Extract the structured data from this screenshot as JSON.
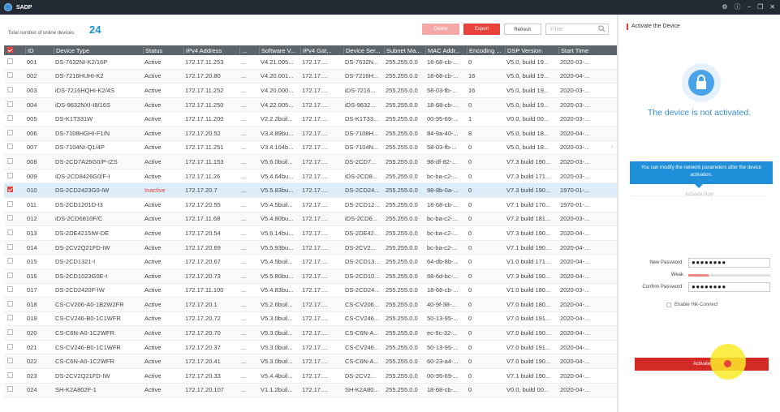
{
  "app": {
    "title": "SADP"
  },
  "summary": {
    "label": "Total number of online devices:",
    "count": "24"
  },
  "toolbar": {
    "delete_label": "Delete",
    "export_label": "Export",
    "refresh_label": "Refresh",
    "filter_placeholder": "Filter"
  },
  "table": {
    "headers": [
      "",
      "ID",
      "Device Type",
      "Status",
      "IPv4 Address",
      "...",
      "Software V...",
      "IPv4 Gat...",
      "Device Ser...",
      "Subnet Ma...",
      "MAC Addr...",
      "Encoding ...",
      "DSP Version",
      "Start Time",
      ""
    ],
    "rows": [
      {
        "id": "001",
        "type": "DS-7632NI-K2/16P",
        "status": "Active",
        "ip": "172.17.11.253",
        "port": "...",
        "sw": "V4.21.005...",
        "gw": "172.17....",
        "serial": "DS-7632N...",
        "mask": "255.255.0.0",
        "mac": "18-68-cb-...",
        "enc": "0",
        "dsp": "V5.0, build 19...",
        "start": "2020-03-..."
      },
      {
        "id": "002",
        "type": "DS-7216HUHI-K2",
        "status": "Active",
        "ip": "172.17.20.80",
        "port": "...",
        "sw": "V4.20.001...",
        "gw": "172.17....",
        "serial": "DS-7216H...",
        "mask": "255.255.0.0",
        "mac": "18-68-cb-...",
        "enc": "16",
        "dsp": "V5.0, build 19...",
        "start": "2020-04-..."
      },
      {
        "id": "003",
        "type": "iDS-7216HQHI-K2/4S",
        "status": "Active",
        "ip": "172.17.11.252",
        "port": "...",
        "sw": "V4.20.000...",
        "gw": "172.17....",
        "serial": "iDS-7216...",
        "mask": "255.255.0.0",
        "mac": "58-03-fb-...",
        "enc": "16",
        "dsp": "V5.0, build 19...",
        "start": "2020-03-..."
      },
      {
        "id": "004",
        "type": "iDS-9632NXI-I8/16S",
        "status": "Active",
        "ip": "172.17.11.250",
        "port": "...",
        "sw": "V4.22.005...",
        "gw": "172.17....",
        "serial": "iDS-9632...",
        "mask": "255.255.0.0",
        "mac": "18-68-cb-...",
        "enc": "0",
        "dsp": "V5.0, build 19...",
        "start": "2020-03-..."
      },
      {
        "id": "005",
        "type": "DS-K1T331W",
        "status": "Active",
        "ip": "172.17.11.200",
        "port": "...",
        "sw": "V2.2.2buil...",
        "gw": "172.17....",
        "serial": "DS-K1T33...",
        "mask": "255.255.0.0",
        "mac": "00-95-69-...",
        "enc": "1",
        "dsp": "V0.0, build 00...",
        "start": "2020-03-..."
      },
      {
        "id": "006",
        "type": "DS-7108HGHI-F1/N",
        "status": "Active",
        "ip": "172.17.20.52",
        "port": "...",
        "sw": "V3.4.89bu...",
        "gw": "172.17....",
        "serial": "DS-7108H...",
        "mask": "255.255.0.0",
        "mac": "84-9a-40-...",
        "enc": "8",
        "dsp": "V5.0, build 18...",
        "start": "2020-04-..."
      },
      {
        "id": "007",
        "type": "DS-7104NI-Q1/4P",
        "status": "Active",
        "ip": "172.17.11.251",
        "port": "...",
        "sw": "V3.4.104b...",
        "gw": "172.17....",
        "serial": "DS-7104N...",
        "mask": "255.255.0.0",
        "mac": "58-03-fb-...",
        "enc": "0",
        "dsp": "V5.0, build 18...",
        "start": "2020-03-..."
      },
      {
        "id": "008",
        "type": "DS-2CD7A26G0/P-IZS",
        "status": "Active",
        "ip": "172.17.11.153",
        "port": "...",
        "sw": "V5.6.0buil...",
        "gw": "172.17....",
        "serial": "DS-2CD7...",
        "mask": "255.255.0.0",
        "mac": "98-df-82-...",
        "enc": "0",
        "dsp": "V7.3 build 190...",
        "start": "2020-03-..."
      },
      {
        "id": "009",
        "type": "iDS-2CD8426G0/F-I",
        "status": "Active",
        "ip": "172.17.11.26",
        "port": "...",
        "sw": "V5.4.64bu...",
        "gw": "172.17....",
        "serial": "iDS-2CD8...",
        "mask": "255.255.0.0",
        "mac": "bc-ba-c2-...",
        "enc": "0",
        "dsp": "V7.3 build 171...",
        "start": "2020-03-..."
      },
      {
        "id": "010",
        "type": "DS-2CD2423G0-IW",
        "status": "Inactive",
        "ip": "172.17.20.7",
        "port": "...",
        "sw": "V5.5.83bu...",
        "gw": "172.17....",
        "serial": "DS-2CD24...",
        "mask": "255.255.0.0",
        "mac": "98-8b-0a-...",
        "enc": "0",
        "dsp": "V7.3 build 190...",
        "start": "1970-01-..."
      },
      {
        "id": "011",
        "type": "DS-2CD1201D-I3",
        "status": "Active",
        "ip": "172.17.20.55",
        "port": "...",
        "sw": "V5.4.5buil...",
        "gw": "172.17....",
        "serial": "DS-2CD12...",
        "mask": "255.255.0.0",
        "mac": "18-68-cb-...",
        "enc": "0",
        "dsp": "V7.1 build 170...",
        "start": "1970-01-..."
      },
      {
        "id": "012",
        "type": "iDS-2CD6810F/C",
        "status": "Active",
        "ip": "172.17.11.68",
        "port": "...",
        "sw": "V5.4.80bu...",
        "gw": "172.17....",
        "serial": "iDS-2CD6...",
        "mask": "255.255.0.0",
        "mac": "bc-ba-c2-...",
        "enc": "0",
        "dsp": "V7.2 build 181...",
        "start": "2020-03-..."
      },
      {
        "id": "013",
        "type": "DS-2DE4215IW-DE",
        "status": "Active",
        "ip": "172.17.20.54",
        "port": "...",
        "sw": "V5.6.14bu...",
        "gw": "172.17....",
        "serial": "DS-2DE42...",
        "mask": "255.255.0.0",
        "mac": "bc-ba-c2-...",
        "enc": "0",
        "dsp": "V7.3 build 190...",
        "start": "2020-04-..."
      },
      {
        "id": "014",
        "type": "DS-2CV2Q21FD-IW",
        "status": "Active",
        "ip": "172.17.20.69",
        "port": "...",
        "sw": "V5.5.93bu...",
        "gw": "172.17....",
        "serial": "DS-2CV2...",
        "mask": "255.255.0.0",
        "mac": "bc-ba-c2-...",
        "enc": "0",
        "dsp": "V7.1 build 190...",
        "start": "2020-04-..."
      },
      {
        "id": "015",
        "type": "DS-2CD1321-I",
        "status": "Active",
        "ip": "172.17.20.67",
        "port": "...",
        "sw": "V5.4.5buil...",
        "gw": "172.17....",
        "serial": "DS-2CD13...",
        "mask": "255.255.0.0",
        "mac": "64-db-8b-...",
        "enc": "0",
        "dsp": "V1.0 build 171...",
        "start": "2020-04-..."
      },
      {
        "id": "016",
        "type": "DS-2CD1023G0E-I",
        "status": "Active",
        "ip": "172.17.20.73",
        "port": "...",
        "sw": "V5.5.80bu...",
        "gw": "172.17....",
        "serial": "DS-2CD10...",
        "mask": "255.255.0.0",
        "mac": "68-6d-bc-...",
        "enc": "0",
        "dsp": "V7.3 build 190...",
        "start": "2020-04-..."
      },
      {
        "id": "017",
        "type": "DS-2CD2420F-IW",
        "status": "Active",
        "ip": "172.17.11.100",
        "port": "...",
        "sw": "V5.4.83bu...",
        "gw": "172.17....",
        "serial": "DS-2CD24...",
        "mask": "255.255.0.0",
        "mac": "18-68-cb-...",
        "enc": "0",
        "dsp": "V1.0 build 180...",
        "start": "2020-03-..."
      },
      {
        "id": "018",
        "type": "CS-CV206-A0-1B2W2FR",
        "status": "Active",
        "ip": "172.17.20.1",
        "port": "...",
        "sw": "V5.2.6buil...",
        "gw": "172.17....",
        "serial": "CS-CV206...",
        "mask": "255.255.0.0",
        "mac": "40-9f-38-...",
        "enc": "0",
        "dsp": "V7.0 build 180...",
        "start": "2020-04-..."
      },
      {
        "id": "019",
        "type": "CS-CV246-B0-1C1WFR",
        "status": "Active",
        "ip": "172.17.20.72",
        "port": "...",
        "sw": "V5.3.0buil...",
        "gw": "172.17....",
        "serial": "CS-CV246...",
        "mask": "255.255.0.0",
        "mac": "50-13-95-...",
        "enc": "0",
        "dsp": "V7.0 build 191...",
        "start": "2020-04-..."
      },
      {
        "id": "020",
        "type": "CS-C6N-A0-1C2WFR",
        "status": "Active",
        "ip": "172.17.20.70",
        "port": "...",
        "sw": "V5.3.0buil...",
        "gw": "172.17....",
        "serial": "CS-C6N-A...",
        "mask": "255.255.0.0",
        "mac": "ec-9c-32-...",
        "enc": "0",
        "dsp": "V7.0 build 190...",
        "start": "2020-04-..."
      },
      {
        "id": "021",
        "type": "CS-CV246-B0-1C1WFR",
        "status": "Active",
        "ip": "172.17.20.37",
        "port": "...",
        "sw": "V5.3.0buil...",
        "gw": "172.17....",
        "serial": "CS-CV246...",
        "mask": "255.255.0.0",
        "mac": "50-13-95-...",
        "enc": "0",
        "dsp": "V7.0 build 191...",
        "start": "2020-04-..."
      },
      {
        "id": "022",
        "type": "CS-C6N-A0-1C2WFR",
        "status": "Active",
        "ip": "172.17.20.41",
        "port": "...",
        "sw": "V5.3.0buil...",
        "gw": "172.17....",
        "serial": "CS-C6N-A...",
        "mask": "255.255.0.0",
        "mac": "60-23-a4-...",
        "enc": "0",
        "dsp": "V7.0 build 190...",
        "start": "2020-04-..."
      },
      {
        "id": "023",
        "type": "DS-2CV2Q21FD-IW",
        "status": "Active",
        "ip": "172.17.20.33",
        "port": "...",
        "sw": "V5.4.4buil...",
        "gw": "172.17....",
        "serial": "DS-2CV2...",
        "mask": "255.255.0.0",
        "mac": "00-95-69-...",
        "enc": "0",
        "dsp": "V7.1 build 190...",
        "start": "2020-04-..."
      },
      {
        "id": "024",
        "type": "SH-K2A802F-1",
        "status": "Active",
        "ip": "172.17.20.107",
        "port": "...",
        "sw": "V1.1.2buil...",
        "gw": "172.17....",
        "serial": "SH-K2A80...",
        "mask": "255.255.0.0",
        "mac": "18-68-cb-...",
        "enc": "0",
        "dsp": "V0.0, build 00...",
        "start": "2020-04-..."
      }
    ],
    "selected_id": "010"
  },
  "activate_panel": {
    "title": "Activate the Device",
    "status_text": "The device is not activated.",
    "tip_text": "You can modify the network parameters after the device activation.",
    "activate_now": "Activate Now",
    "new_password_label": "New Password:",
    "new_password_value": "●●●●●●●●",
    "strength_label": "Weak",
    "strength_level": 0.25,
    "confirm_password_label": "Confirm Password:",
    "confirm_password_value": "●●●●●●●●",
    "hik_connect_label": "Enable Hik-Connect",
    "activate_button": "Activate"
  },
  "colors": {
    "accent": "#1e8fd8",
    "danger": "#e8423a",
    "header": "#5d646c",
    "titlebar": "#232a33"
  }
}
